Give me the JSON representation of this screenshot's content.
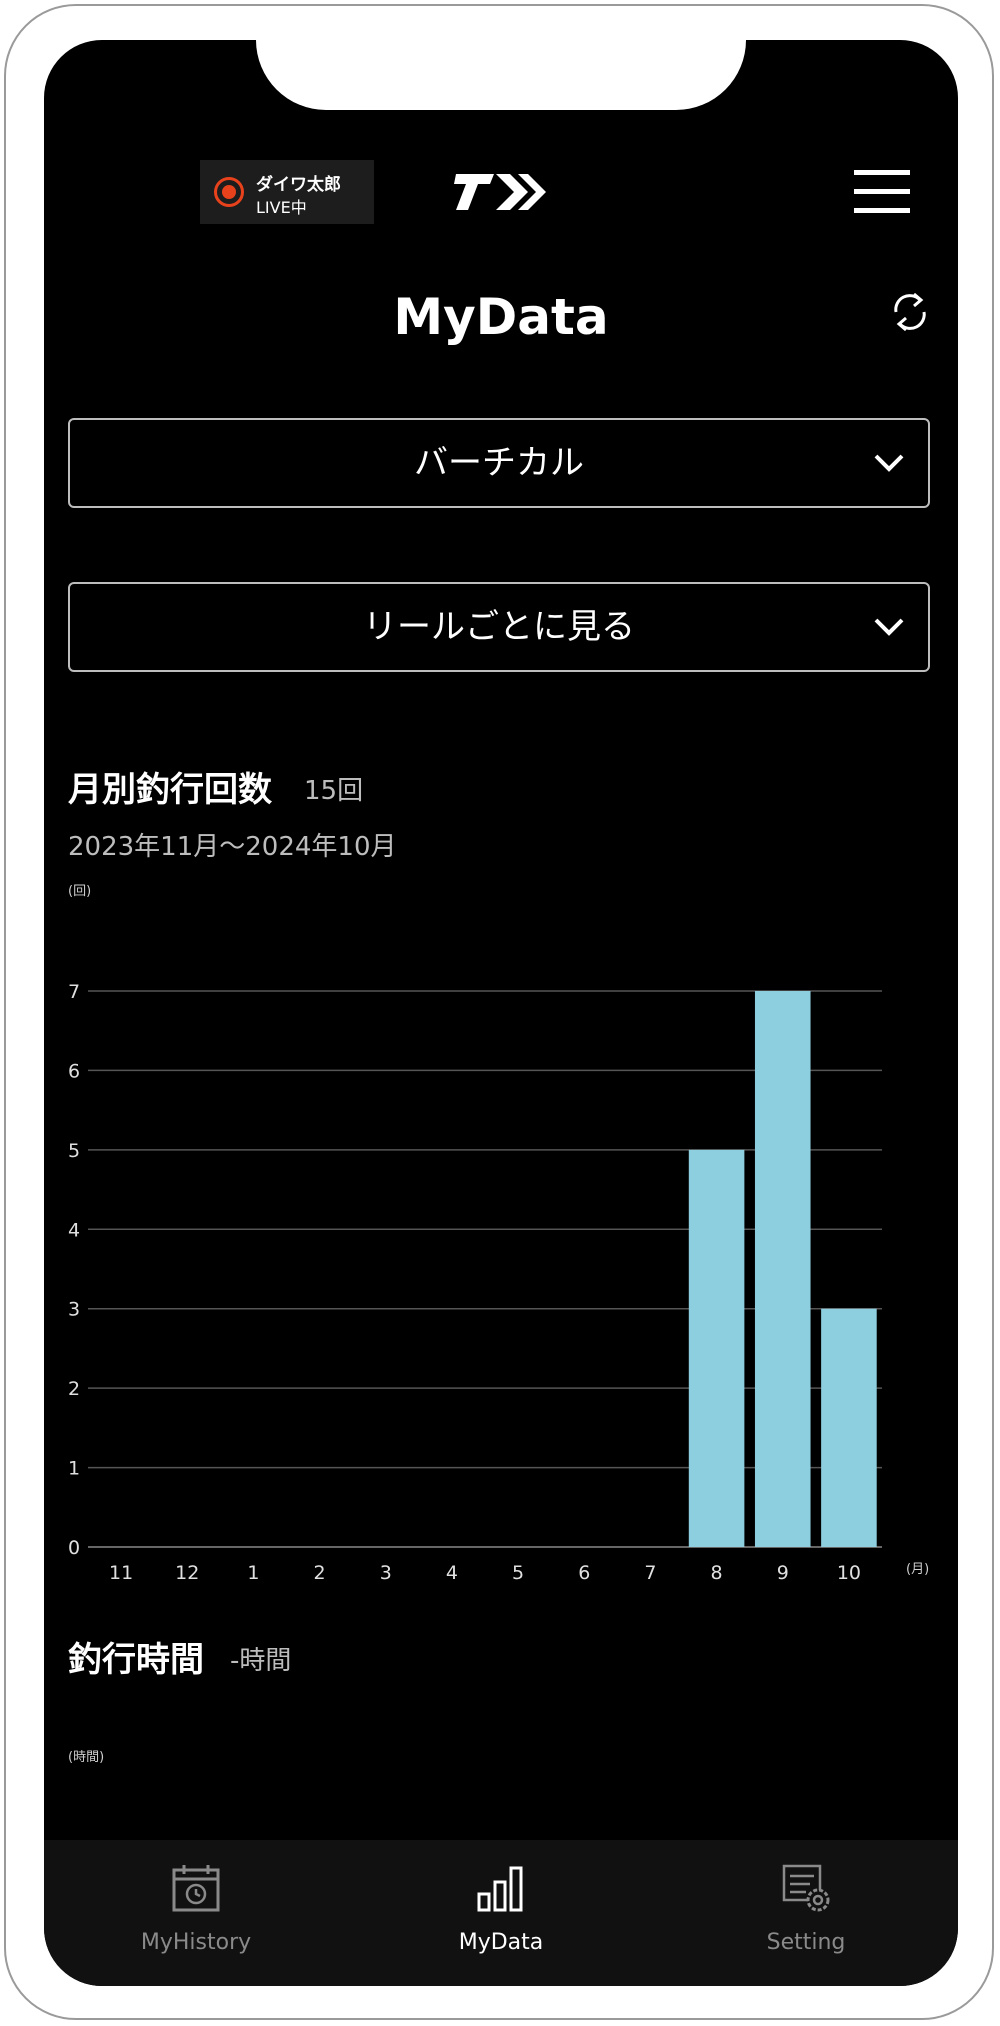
{
  "header": {
    "live_name": "ダイワ太郎",
    "live_status": "LIVE中",
    "logo_icon": "daiwa-logo-icon",
    "menu_icon": "hamburger-menu-icon",
    "title": "MyData",
    "refresh_icon": "refresh-icon"
  },
  "filters": {
    "category": "バーチカル",
    "view_mode": "リールごとに見る"
  },
  "monthly_trips": {
    "title": "月別釣行回数",
    "total": "15回",
    "date_range": "2023年11月〜2024年10月",
    "y_unit": "(回)",
    "x_unit": "(月)"
  },
  "fishing_time": {
    "title": "釣行時間",
    "total": "-時間",
    "y_unit": "(時間)"
  },
  "chart_data": {
    "type": "bar",
    "title": "月別釣行回数",
    "xlabel": "(月)",
    "ylabel": "(回)",
    "categories": [
      "11",
      "12",
      "1",
      "2",
      "3",
      "4",
      "5",
      "6",
      "7",
      "8",
      "9",
      "10"
    ],
    "values": [
      0,
      0,
      0,
      0,
      0,
      0,
      0,
      0,
      0,
      5,
      7,
      3
    ],
    "y_ticks": [
      "0",
      "1",
      "2",
      "3",
      "4",
      "5",
      "6",
      "7"
    ],
    "ylim": [
      0,
      7
    ],
    "grid": true,
    "bar_color": "#8ecfdf"
  },
  "tabbar": {
    "items": [
      {
        "label": "MyHistory",
        "icon": "calendar-history-icon",
        "active": false
      },
      {
        "label": "MyData",
        "icon": "bar-chart-icon",
        "active": true
      },
      {
        "label": "Setting",
        "icon": "settings-gear-icon",
        "active": false
      }
    ]
  },
  "colors": {
    "background": "#000000",
    "accent_bar": "#8ecfdf",
    "live_red": "#e8421c",
    "tab_active": "#ffffff",
    "tab_inactive": "#8a8a8a"
  }
}
